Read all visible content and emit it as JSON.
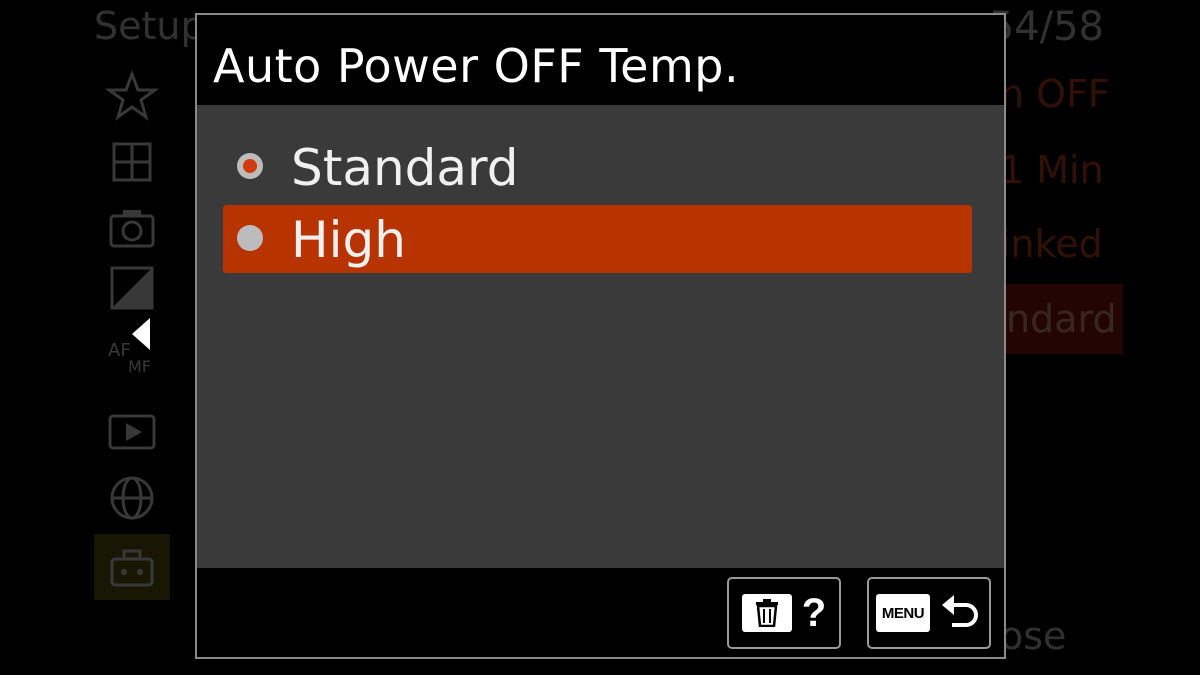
{
  "background_menu": {
    "title": "Setup",
    "page_counter": "54/58",
    "values": [
      "n OFF",
      "1 Min",
      "inked",
      "ndard"
    ],
    "close_label": "ose",
    "tabs": [
      "star-icon",
      "grid-icon",
      "camera-icon",
      "exposure-icon",
      "af-mf-icon",
      "playback-icon",
      "network-globe-icon",
      "toolbox-icon"
    ]
  },
  "dialog": {
    "title": "Auto Power OFF Temp.",
    "options": [
      {
        "label": "Standard",
        "checked": true,
        "highlighted": false
      },
      {
        "label": "High",
        "checked": false,
        "highlighted": true
      }
    ],
    "footer": {
      "help_label": "?",
      "menu_label": "MENU"
    }
  },
  "colors": {
    "highlight": "#b73400",
    "radio_checked": "#d03c10",
    "body_bg": "#3a3a3a"
  }
}
